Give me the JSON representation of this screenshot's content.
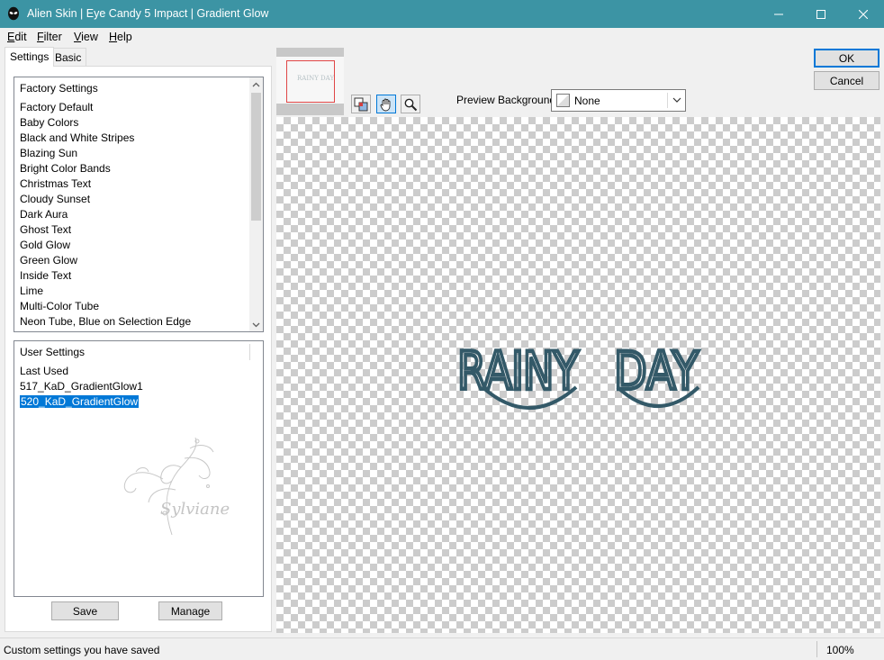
{
  "window": {
    "title": "Alien Skin | Eye Candy 5 Impact | Gradient Glow",
    "icon": "alien-head-icon",
    "controls": [
      "minimize-icon",
      "maximize-icon",
      "close-icon"
    ]
  },
  "menu": [
    {
      "label": "Edit",
      "accel": "E",
      "rest": "dit"
    },
    {
      "label": "Filter",
      "accel": "F",
      "rest": "ilter"
    },
    {
      "label": "View",
      "accel": "V",
      "rest": "iew"
    },
    {
      "label": "Help",
      "accel": "H",
      "rest": "elp"
    }
  ],
  "tabs": {
    "settings": "Settings",
    "basic": "Basic"
  },
  "factory_settings": {
    "header": "Factory Settings",
    "items": [
      "Factory Default",
      "Baby Colors",
      "Black and White Stripes",
      "Blazing Sun",
      "Bright Color Bands",
      "Christmas Text",
      "Cloudy Sunset",
      "Dark Aura",
      "Ghost Text",
      "Gold Glow",
      "Green Glow",
      "Inside Text",
      "Lime",
      "Multi-Color Tube",
      "Neon Tube, Blue on Selection Edge"
    ]
  },
  "user_settings": {
    "header": "User Settings",
    "items": [
      "Last Used",
      "517_KaD_GradientGlow1",
      "520_KaD_GradientGlow"
    ],
    "selected_index": 2,
    "watermark": "Sylviane"
  },
  "buttons": {
    "save": "Save",
    "manage": "Manage",
    "ok": "OK",
    "cancel": "Cancel"
  },
  "thumbnail": {
    "text": "RAINY DAY"
  },
  "preview_background": {
    "label": "Preview Background:",
    "value": "None"
  },
  "preview": {
    "word1": "RAINY",
    "word2": "DAY",
    "text_color": "#335968"
  },
  "status": {
    "text": "Custom settings you have saved",
    "zoom": "100%"
  },
  "colors": {
    "titlebar": "#3c94a4",
    "selection": "#0078d7"
  }
}
